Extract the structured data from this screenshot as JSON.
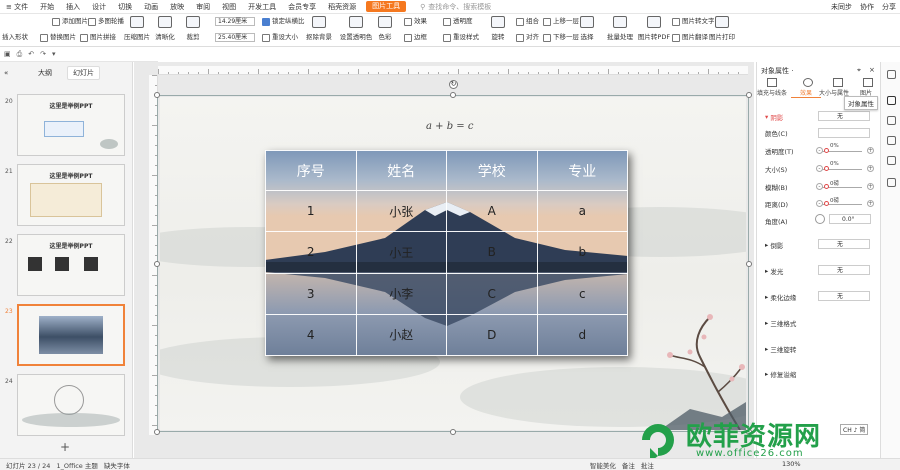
{
  "menubar": {
    "items": [
      "≡ 文件",
      "开始",
      "插入",
      "设计",
      "切换",
      "动画",
      "放映",
      "审阅",
      "视图",
      "开发工具",
      "会员专享",
      "稻壳资源",
      "图片工具"
    ],
    "active_index": 12,
    "search_placeholder": "查找命令、搜索模板",
    "right": [
      "未同步",
      "协作",
      "分享"
    ]
  },
  "ribbon": {
    "row1": [
      "添加图片",
      "多图轮播",
      "14.29厘米",
      "锁定纵横比",
      "效果",
      "透明度",
      "组合",
      "上移一层",
      "图片转文字"
    ],
    "row2": [
      "插入形状",
      "替换图片",
      "图片拼接",
      "25.40厘米",
      "重设大小",
      "边框",
      "重设样式",
      "对齐",
      "下移一层",
      "图片翻译"
    ],
    "big": [
      "压缩图片",
      "清晰化",
      "裁剪",
      "抠除背景",
      "设置透明色",
      "色彩",
      "旋转",
      "选择",
      "批量处理",
      "图片转PDF",
      "图片打印"
    ]
  },
  "leftpanel": {
    "tabs": [
      "大纲",
      "幻灯片"
    ],
    "active_tab": 1,
    "slides": [
      {
        "num": "20",
        "title": "这里是举例PPT"
      },
      {
        "num": "21",
        "title": "这里是举例PPT"
      },
      {
        "num": "22",
        "title": "这里是举例PPT"
      },
      {
        "num": "23",
        "title": ""
      },
      {
        "num": "24",
        "title": ""
      }
    ],
    "selected_slide": "23",
    "add_label": "+"
  },
  "slide": {
    "formula": "a + b = c",
    "table": {
      "headers": [
        "序号",
        "姓名",
        "学校",
        "专业"
      ],
      "rows": [
        [
          "1",
          "小张",
          "A",
          "a"
        ],
        [
          "2",
          "小王",
          "B",
          "b"
        ],
        [
          "3",
          "小李",
          "C",
          "c"
        ],
        [
          "4",
          "小赵",
          "D",
          "d"
        ]
      ]
    }
  },
  "rightpanel": {
    "title": "对象属性 ·",
    "tabs": [
      "填充与线条",
      "效果",
      "大小与属性",
      "图片"
    ],
    "active_tab": 1,
    "tooltip": "对象属性",
    "shadow_label": "阴影",
    "shadow_value": "无",
    "rows": [
      {
        "label": "颜色(C)"
      },
      {
        "label": "透明度(T)",
        "value": "0%"
      },
      {
        "label": "大小(S)",
        "value": "0%"
      },
      {
        "label": "模糊(B)",
        "value": "0磅"
      },
      {
        "label": "距离(D)",
        "value": "0磅"
      },
      {
        "label": "角度(A)",
        "value": "0.0°"
      }
    ],
    "sections": [
      {
        "label": "倒影",
        "value": "无"
      },
      {
        "label": "发光",
        "value": "无"
      },
      {
        "label": "柔化边缘",
        "value": "无"
      },
      {
        "label": "三维格式"
      },
      {
        "label": "三维旋转"
      },
      {
        "label": "修复溢缩"
      }
    ]
  },
  "status": {
    "slide_info": "幻灯片 23 / 24",
    "theme": "1_Office 主题",
    "font_missing": "缺失字体",
    "smart": "智能美化",
    "notes": "备注",
    "comments": "批注",
    "zoom": "130%"
  },
  "ime": "CH ♪ 简",
  "watermark": {
    "text": "欧菲资源网",
    "url": "www.office26.com"
  },
  "colors": {
    "accent": "#f5781f",
    "selection": "#f0823a",
    "watermark": "#23a04a"
  }
}
